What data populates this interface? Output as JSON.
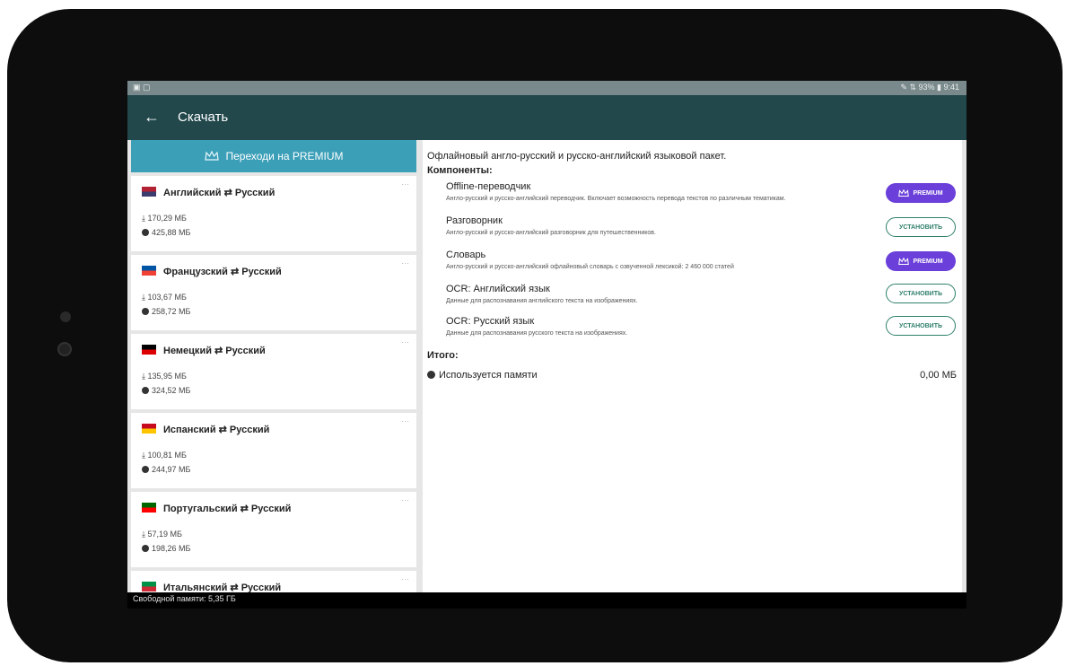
{
  "statusbar": {
    "left_icons": "▣ ▢",
    "right_status": "✎ ⇅ 93% ▮ 9:41"
  },
  "appbar": {
    "back_icon": "←",
    "title": "Скачать"
  },
  "premium_button": {
    "icon": "crown-icon",
    "label": "Переходи на PREMIUM"
  },
  "packs": [
    {
      "name": "Английский ⇄ Русский",
      "download_size": "⤓ 170,29 МБ",
      "disk_size": "425,88 МБ",
      "flag_colors": [
        "#b22234",
        "#3c3b6e"
      ]
    },
    {
      "name": "Французский ⇄ Русский",
      "download_size": "⤓ 103,67 МБ",
      "disk_size": "258,72 МБ",
      "flag_colors": [
        "#0055a4",
        "#ef4135"
      ]
    },
    {
      "name": "Немецкий ⇄ Русский",
      "download_size": "⤓ 135,95 МБ",
      "disk_size": "324,52 МБ",
      "flag_colors": [
        "#000000",
        "#dd0000"
      ]
    },
    {
      "name": "Испанский ⇄ Русский",
      "download_size": "⤓ 100,81 МБ",
      "disk_size": "244,97 МБ",
      "flag_colors": [
        "#c60b1e",
        "#ffc400"
      ]
    },
    {
      "name": "Португальский ⇄ Русский",
      "download_size": "⤓ 57,19 МБ",
      "disk_size": "198,26 МБ",
      "flag_colors": [
        "#006600",
        "#ff0000"
      ]
    },
    {
      "name": "Итальянский ⇄ Русский",
      "download_size": "",
      "disk_size": "",
      "flag_colors": [
        "#009246",
        "#ce2b37"
      ]
    }
  ],
  "detail": {
    "description": "Офлайновый англо-русский и русско-английский языковой пакет.",
    "components_heading": "Компоненты:",
    "components": [
      {
        "title": "Offline-переводчик",
        "subtitle": "Англо-русский и русско-английский переводчик. Включает возможность перевода текстов по различным тематикам.",
        "action": "premium",
        "action_label": "PREMIUM"
      },
      {
        "title": "Разговорник",
        "subtitle": "Англо-русский и русско-английский разговорник для путешественников.",
        "action": "install",
        "action_label": "УСТАНОВИТЬ"
      },
      {
        "title": "Словарь",
        "subtitle": "Англо-русский и русско-английский офлайновый словарь с озвученной лексикой: 2 460 000 статей",
        "action": "premium",
        "action_label": "PREMIUM"
      },
      {
        "title": "OCR: Английский язык",
        "subtitle": "Данные для распознавания английского текста на изображениях.",
        "action": "install",
        "action_label": "УСТАНОВИТЬ"
      },
      {
        "title": "OCR: Русский язык",
        "subtitle": "Данные для распознавания русского текста на изображениях.",
        "action": "install",
        "action_label": "УСТАНОВИТЬ"
      }
    ],
    "total_heading": "Итого:",
    "memory_label": "Используется памяти",
    "memory_value": "0,00 МБ"
  },
  "footer": {
    "free_memory": "Свободной памяти: 5,35 ГБ"
  },
  "colors": {
    "appbar": "#22484c",
    "premium_cta": "#3b9fb8",
    "premium_badge": "#6b3fd9",
    "install": "#2f7f6a"
  }
}
